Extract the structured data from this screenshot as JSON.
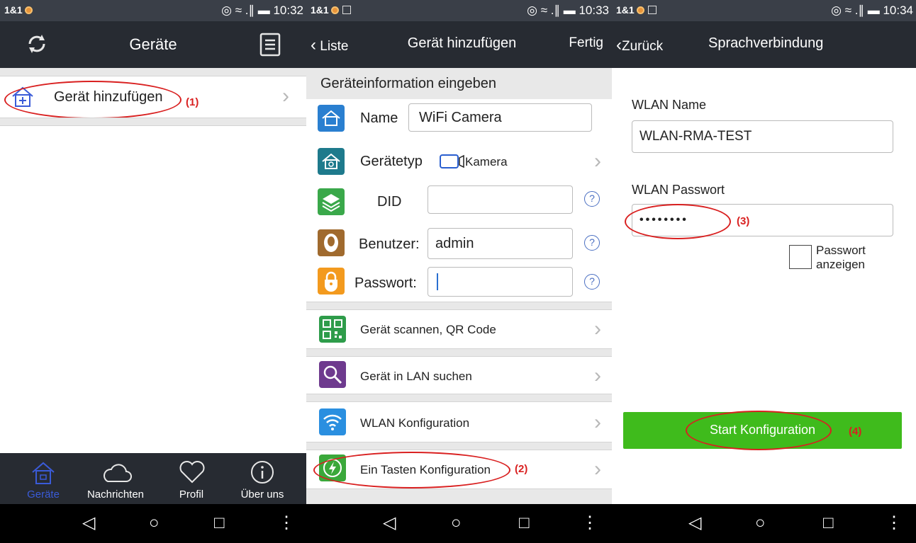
{
  "status_left_1": "1&1",
  "status_left_2": "1&1",
  "status_left_3": "1&1",
  "status_icons": "◎ ≈ .∥ ▬",
  "time_1": "10:32",
  "time_2": "10:33",
  "time_3": "10:34",
  "screen1": {
    "title": "Geräte",
    "add_device_label": "Gerät hinzufügen",
    "annotation": "(1)",
    "tabs": [
      {
        "label": "Geräte",
        "icon": "home-icon",
        "active": true
      },
      {
        "label": "Nachrichten",
        "icon": "cloud-icon"
      },
      {
        "label": "Profil",
        "icon": "heart-icon"
      },
      {
        "label": "Über uns",
        "icon": "info-icon"
      }
    ]
  },
  "screen2": {
    "back_label": "Liste",
    "title": "Gerät hinzufügen",
    "done_label": "Fertig",
    "section_header": "Geräteinformation eingeben",
    "name_label": "Name",
    "name_value": "WiFi Camera",
    "type_label": "Gerätetyp",
    "type_value": "Kamera",
    "did_label": "DID",
    "did_value": "",
    "user_label": "Benutzer:",
    "user_value": "admin",
    "password_label": "Passwort:",
    "password_value": "",
    "menu": [
      {
        "label": "Gerät scannen, QR Code"
      },
      {
        "label": "Gerät in LAN suchen"
      },
      {
        "label": "WLAN Konfiguration"
      },
      {
        "label": "Ein Tasten Konfiguration"
      }
    ],
    "annotation": "(2)"
  },
  "screen3": {
    "back_label": "Zurück",
    "title": "Sprachverbindung",
    "wlan_name_label": "WLAN Name",
    "wlan_name_value": "WLAN-RMA-TEST",
    "wlan_password_label": "WLAN Passwort",
    "wlan_password_value": "••••••••",
    "annotation_3": "(3)",
    "show_password_label_1": "Passwort",
    "show_password_label_2": "anzeigen",
    "start_button_label": "Start Konfiguration",
    "annotation_4": "(4)"
  },
  "colors": {
    "statusbar": "#3a3f48",
    "navbar": "#272b32",
    "accent_green": "#3fbb1c",
    "annotation_red": "#d92020",
    "tab_active": "#3a5bd8"
  }
}
